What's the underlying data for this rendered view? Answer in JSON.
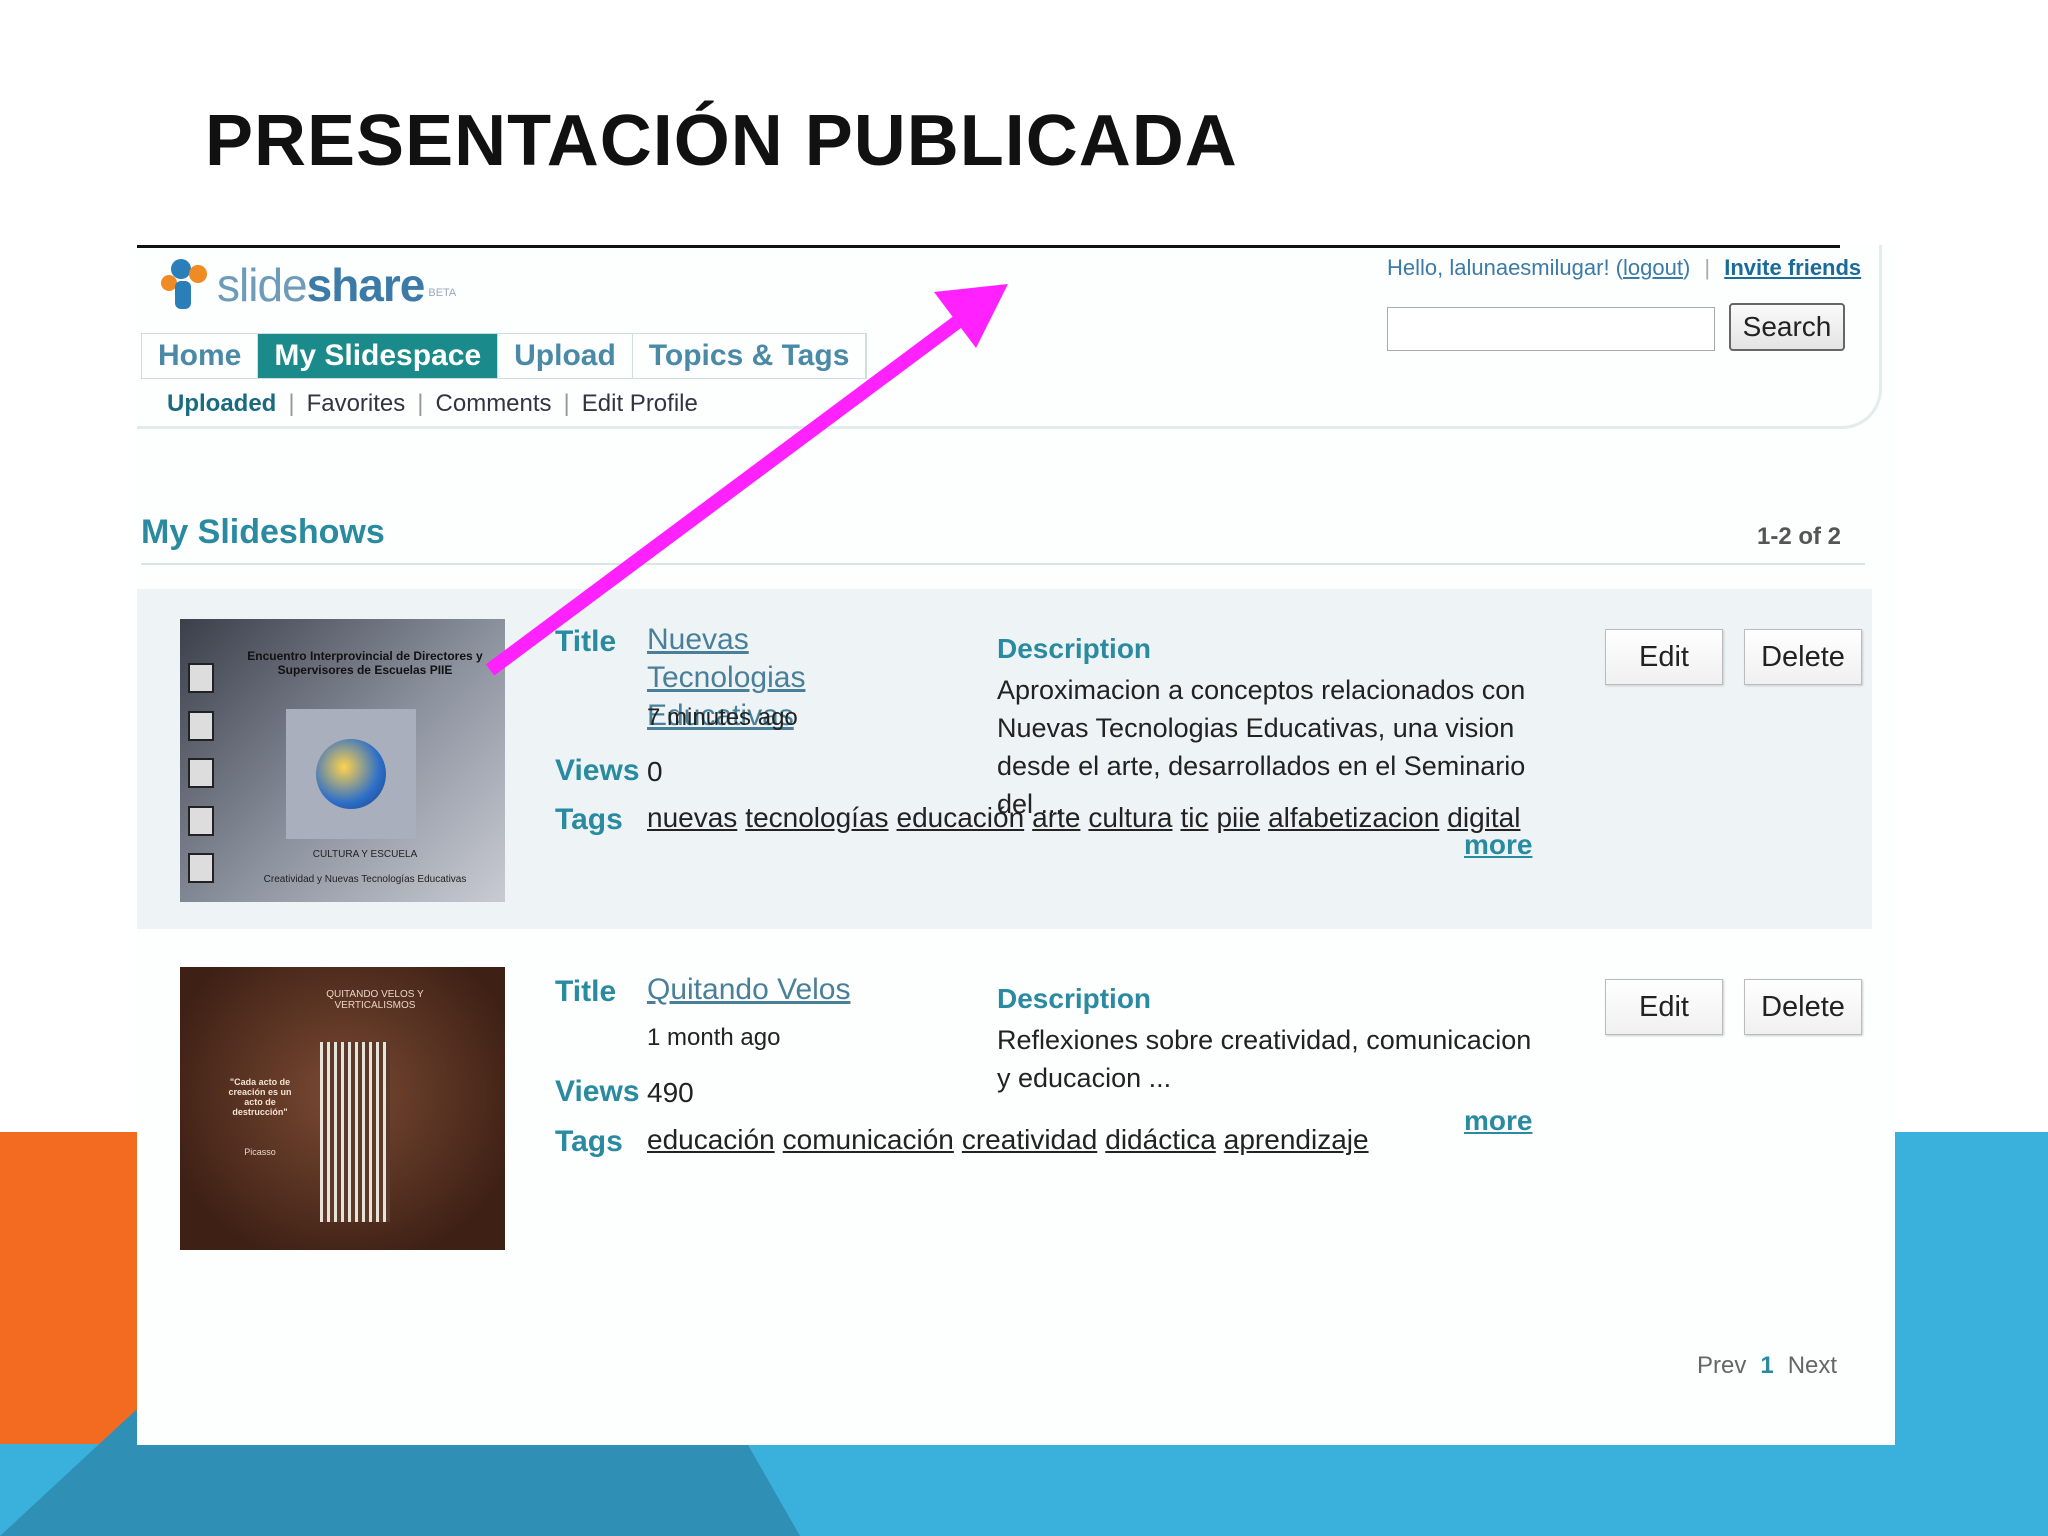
{
  "slide": {
    "title": "PRESENTACIÓN PUBLICADA",
    "colors": {
      "orange": "#f26b21",
      "blue": "#3ab0dd",
      "arrow": "#ff22ff"
    }
  },
  "app": {
    "logo_text_light": "slide",
    "logo_text_bold": "share",
    "logo_beta": "BETA",
    "nav_tabs": [
      {
        "label": "Home",
        "active": false
      },
      {
        "label": "My Slidespace",
        "active": true
      },
      {
        "label": "Upload",
        "active": false
      },
      {
        "label": "Topics & Tags",
        "active": false
      }
    ],
    "subnav": [
      "Uploaded",
      "Favorites",
      "Comments",
      "Edit Profile"
    ],
    "user": {
      "greeting": "Hello, lalunaesmilugar! (",
      "logout": "logout",
      "close_paren": ")",
      "invite": "Invite friends"
    },
    "search": {
      "placeholder": "",
      "button_label": "Search"
    },
    "section_title": "My Slideshows",
    "count": "1-2 of 2",
    "labels": {
      "title": "Title",
      "views": "Views",
      "tags": "Tags",
      "description": "Description",
      "more": "more",
      "edit": "Edit",
      "delete": "Delete"
    },
    "slideshows": [
      {
        "title": "Nuevas Tecnologias Educativas",
        "time": "7 minutes ago",
        "views": "0",
        "tags": [
          "nuevas",
          "tecnologías",
          "educación",
          "arte",
          "cultura",
          "tic",
          "piie",
          "alfabetizacion",
          "digital"
        ],
        "description": "Aproximacion a conceptos relacionados con Nuevas Tecnologias Educativas, una vision desde el arte, desarrollados en el Seminario del ...",
        "thumb": {
          "caption": "Encuentro Interprovincial de Directores y Supervisores de Escuelas PIIE",
          "sub1": "CULTURA Y ESCUELA",
          "sub2": "Creatividad y Nuevas Tecnologías Educativas"
        }
      },
      {
        "title": "Quitando Velos",
        "time": "1 month ago",
        "views": "490",
        "tags": [
          "educación",
          "comunicación",
          "creatividad",
          "didáctica",
          "aprendizaje"
        ],
        "description": "Reflexiones sobre creatividad, comunicacion y educacion ...",
        "thumb": {
          "caption": "QUITANDO VELOS Y VERTICALISMOS",
          "quote": "\"Cada acto de creación es un acto de destrucción\"",
          "author": "Picasso"
        }
      }
    ],
    "pager": {
      "prev": "Prev",
      "current": "1",
      "next": "Next"
    }
  }
}
